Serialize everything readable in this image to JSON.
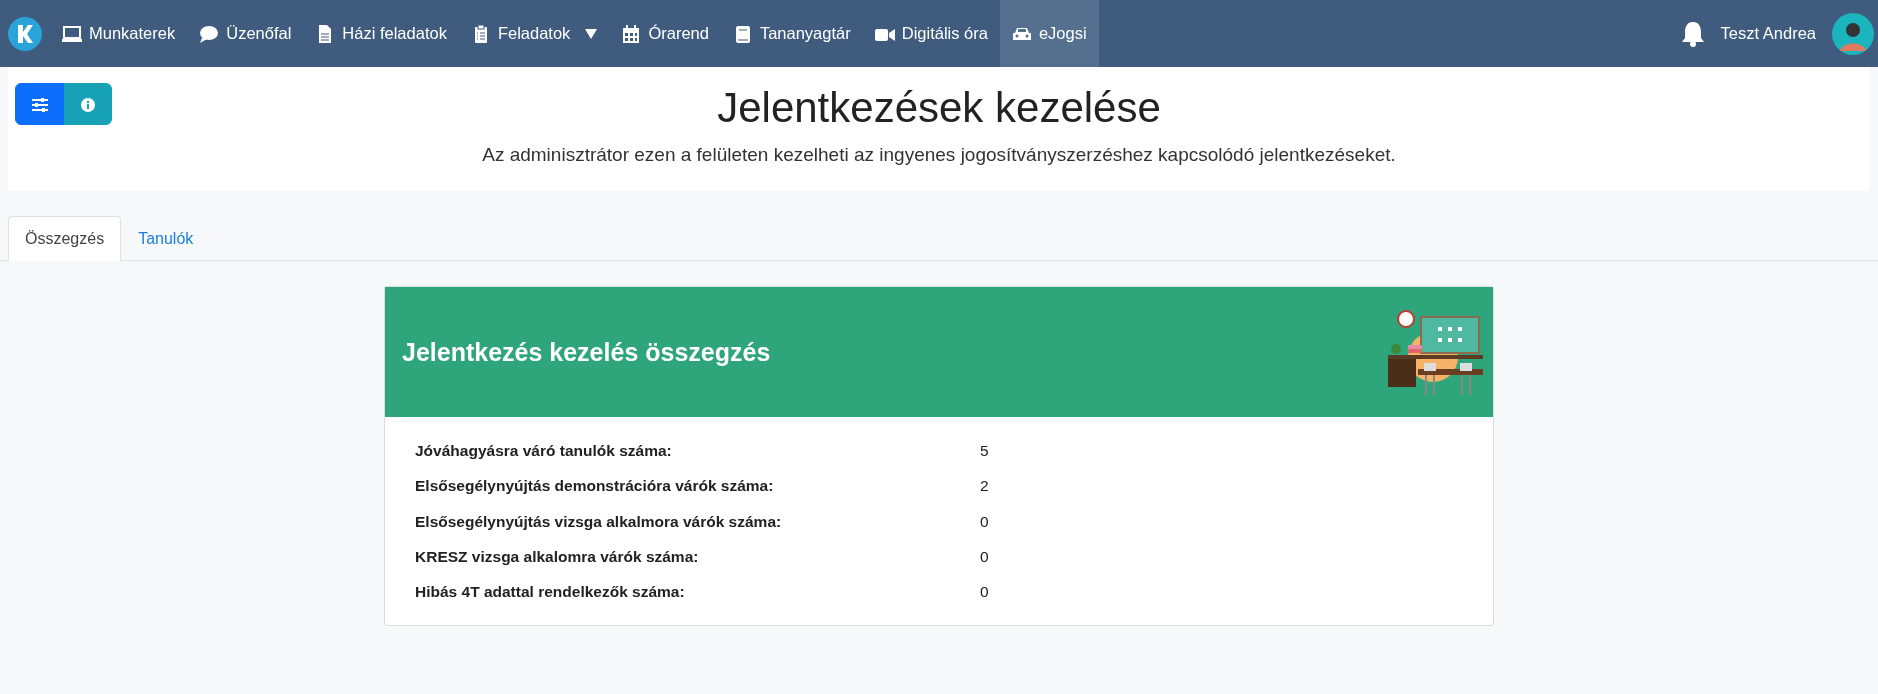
{
  "navbar": {
    "items": [
      {
        "label": "Munkaterek",
        "kind": "laptop",
        "selected": false,
        "dropdown": false
      },
      {
        "label": "Üzenőfal",
        "kind": "chat",
        "selected": false,
        "dropdown": false
      },
      {
        "label": "Házi feladatok",
        "kind": "file",
        "selected": false,
        "dropdown": false
      },
      {
        "label": "Feladatok",
        "kind": "clipboard",
        "selected": false,
        "dropdown": true
      },
      {
        "label": "Órarend",
        "kind": "calendar",
        "selected": false,
        "dropdown": false
      },
      {
        "label": "Tananyagtár",
        "kind": "book",
        "selected": false,
        "dropdown": false
      },
      {
        "label": "Digitális óra",
        "kind": "video",
        "selected": false,
        "dropdown": false
      },
      {
        "label": "eJogsi",
        "kind": "car",
        "selected": true,
        "dropdown": false
      }
    ],
    "user": "Teszt Andrea"
  },
  "page": {
    "title": "Jelentkezések kezelése",
    "subtitle": "Az adminisztrátor ezen a felületen kezelheti az ingyenes jogosítványszerzéshez kapcsolódó jelentkezéseket."
  },
  "tabs": [
    {
      "label": "Összegzés",
      "selected": true
    },
    {
      "label": "Tanulók",
      "selected": false
    }
  ],
  "summary": {
    "title": "Jelentkezés kezelés összegzés",
    "rows": [
      {
        "label": "Jóváhagyásra váró tanulók száma:",
        "value": "5"
      },
      {
        "label": "Elsősegélynyújtás demonstrációra várók száma:",
        "value": "2"
      },
      {
        "label": "Elsősegélynyújtás vizsga alkalmora várók száma:",
        "value": "0"
      },
      {
        "label": "KRESZ vizsga alkalomra várók száma:",
        "value": "0"
      },
      {
        "label": "Hibás 4T adattal rendelkezők száma:",
        "value": "0"
      }
    ]
  }
}
